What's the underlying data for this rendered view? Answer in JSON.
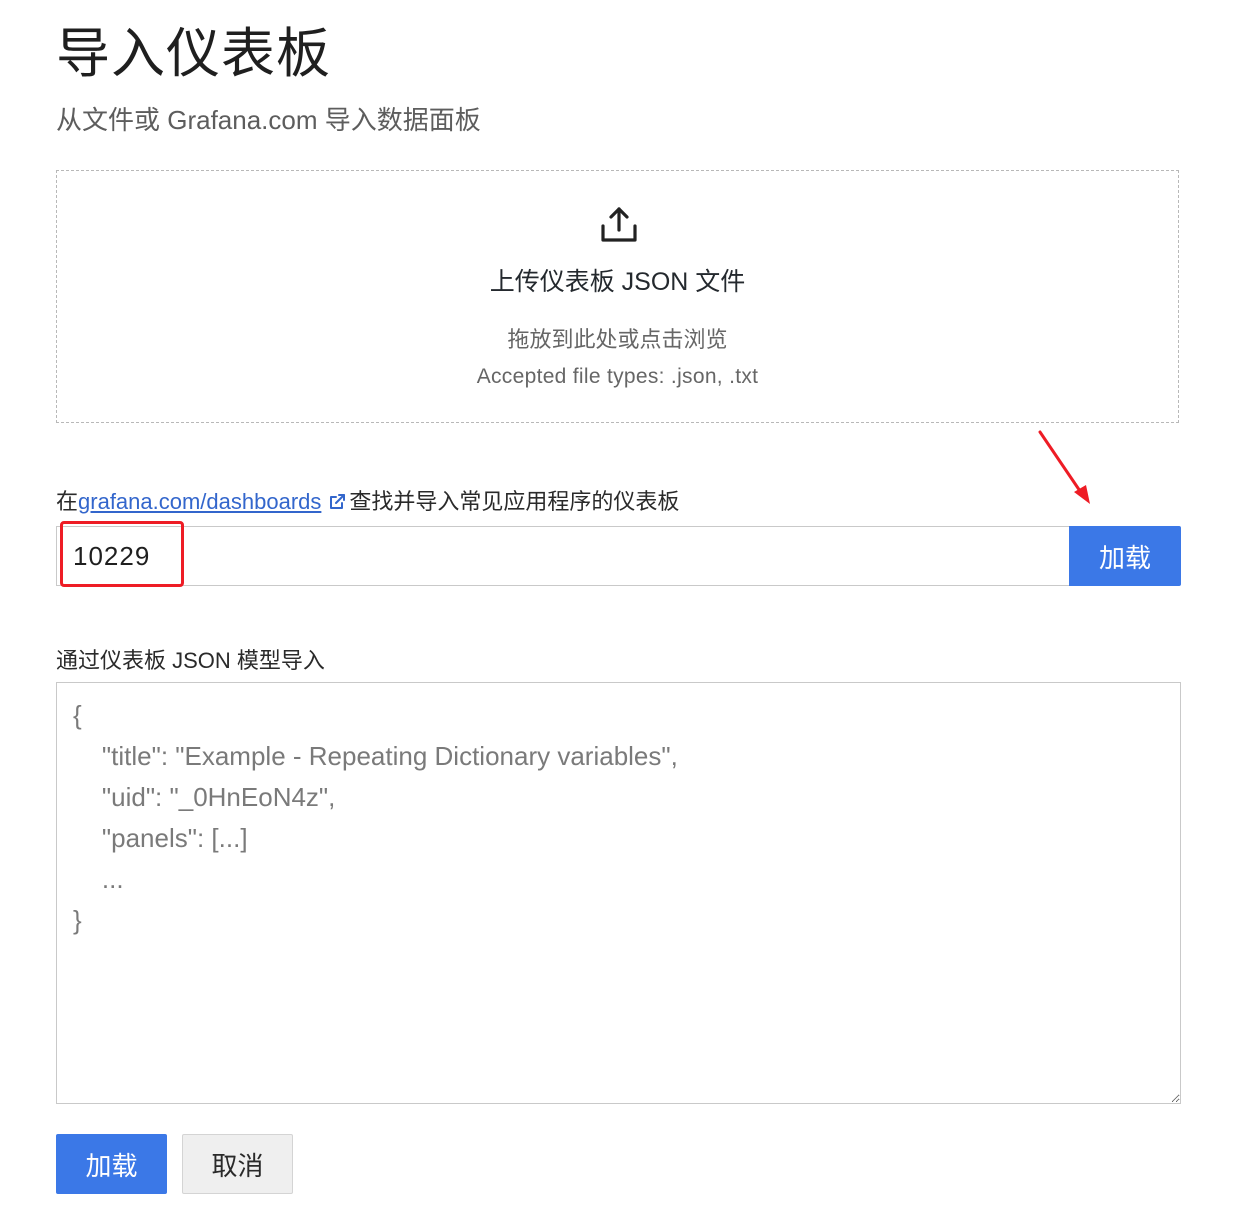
{
  "page": {
    "title": "导入仪表板",
    "subtitle": "从文件或 Grafana.com 导入数据面板"
  },
  "upload": {
    "icon": "upload-icon",
    "title": "上传仪表板 JSON 文件",
    "hint": "拖放到此处或点击浏览",
    "accepted_types": "Accepted file types: .json, .txt"
  },
  "grafana_com": {
    "label_prefix": "在",
    "link_text": "grafana.com/dashboards",
    "link_icon": "external-link-icon",
    "label_suffix": "查找并导入常见应用程序的仪表板",
    "input_value": "10229",
    "load_label": "加载"
  },
  "json_model": {
    "label": "通过仪表板 JSON 模型导入",
    "placeholder": "{\n    \"title\": \"Example - Repeating Dictionary variables\",\n    \"uid\": \"_0HnEoN4z\",\n    \"panels\": [...]\n    ...\n}"
  },
  "actions": {
    "load_label": "加载",
    "cancel_label": "取消"
  },
  "colors": {
    "primary": "#3b78e7",
    "link": "#3366cc",
    "annotation_red": "#ee1c25"
  }
}
